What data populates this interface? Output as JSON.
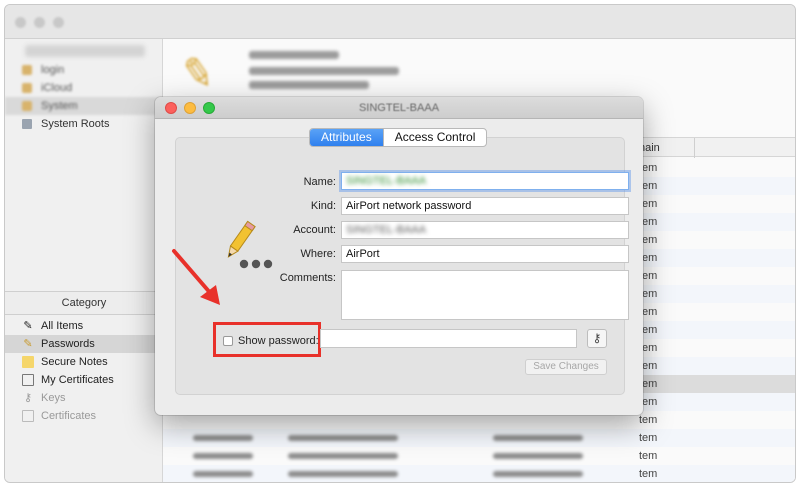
{
  "background": {
    "keychains": [
      {
        "label": "login",
        "blurred": true
      },
      {
        "label": "iCloud",
        "blurred": true
      },
      {
        "label": "System",
        "blurred": true,
        "selected": true
      },
      {
        "label": "System Roots",
        "blurred": false
      }
    ],
    "category_header": "Category",
    "categories": [
      {
        "label": "All Items",
        "icon": "all-items-icon",
        "selected": false
      },
      {
        "label": "Passwords",
        "icon": "passwords-icon",
        "selected": true
      },
      {
        "label": "Secure Notes",
        "icon": "secure-notes-icon",
        "selected": false
      },
      {
        "label": "My Certificates",
        "icon": "my-certificates-icon",
        "selected": false
      },
      {
        "label": "Keys",
        "icon": "keys-icon",
        "selected": false
      },
      {
        "label": "Certificates",
        "icon": "certificates-icon",
        "selected": false
      }
    ],
    "column_header": "hain",
    "row_text": "tem"
  },
  "dialog": {
    "title": "SINGTEL-BAAA",
    "tabs": [
      {
        "label": "Attributes",
        "active": true
      },
      {
        "label": "Access Control",
        "active": false
      }
    ],
    "fields": {
      "name_label": "Name:",
      "name_value": "SINGTEL-BAAA",
      "kind_label": "Kind:",
      "kind_value": "AirPort network password",
      "account_label": "Account:",
      "account_value": "SINGTEL-BAAA",
      "where_label": "Where:",
      "where_value": "AirPort",
      "comments_label": "Comments:",
      "comments_value": ""
    },
    "show_password_label": "Show password:",
    "show_password_checked": false,
    "password_value": "",
    "save_button": "Save Changes"
  },
  "colors": {
    "accent": "#2f80ee",
    "highlight": "#e8312a"
  }
}
